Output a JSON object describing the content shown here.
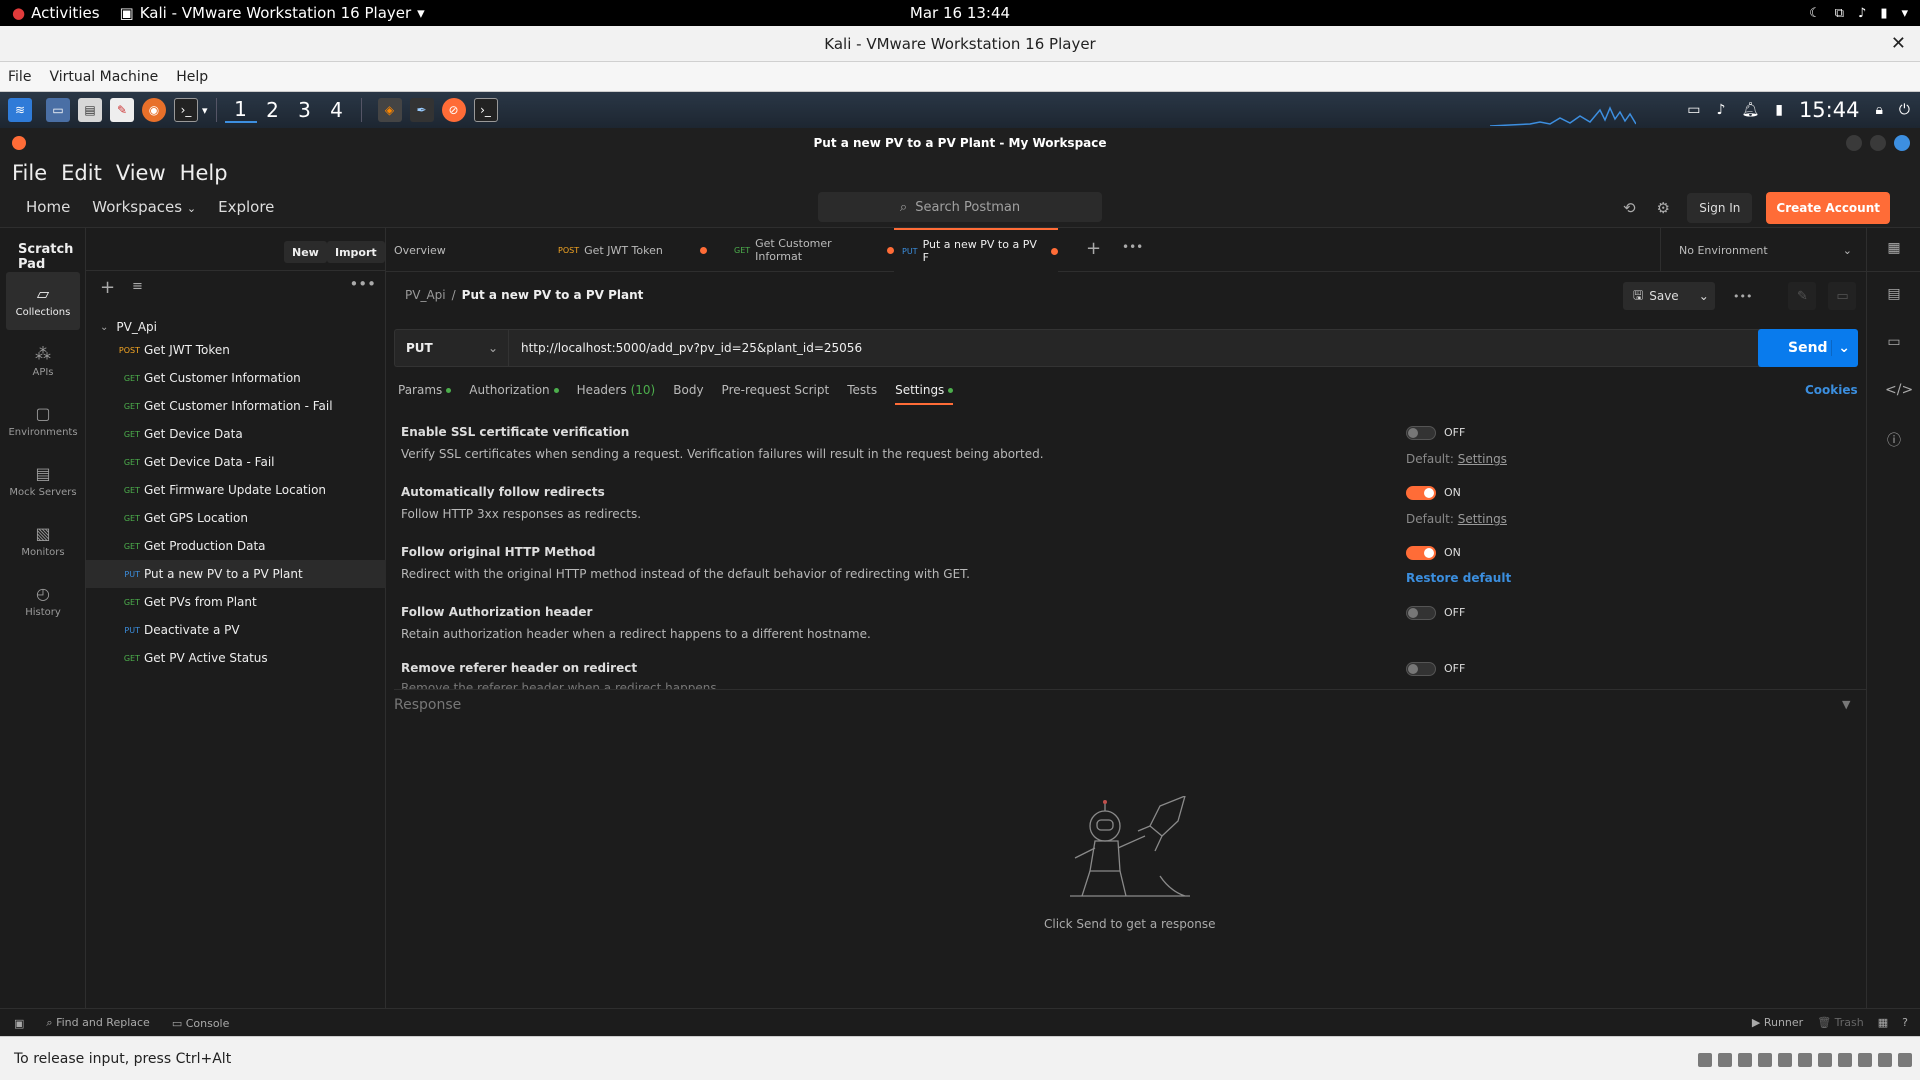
{
  "gnome": {
    "activities": "Activities",
    "app_title": "Kali - VMware Workstation 16 Player",
    "clock": "Mar 16  13:44"
  },
  "vmware": {
    "title": "Kali - VMware Workstation 16 Player",
    "menu": [
      "File",
      "Virtual Machine",
      "Help"
    ],
    "status_hint": "To release input, press Ctrl+Alt"
  },
  "kali_panel": {
    "workspaces": [
      "1",
      "2",
      "3",
      "4"
    ],
    "active_workspace": "1",
    "time": "15:44"
  },
  "postman": {
    "window_title": "Put a new PV to a PV Plant - My Workspace",
    "menu": [
      "File",
      "Edit",
      "View",
      "Help"
    ],
    "nav": {
      "home": "Home",
      "workspaces": "Workspaces",
      "explore": "Explore"
    },
    "search_placeholder": "Search Postman",
    "sign_in": "Sign In",
    "create_account": "Create Account",
    "scratch_pad": "Scratch Pad",
    "new_btn": "New",
    "import_btn": "Import",
    "rail": [
      "Collections",
      "APIs",
      "Environments",
      "Mock Servers",
      "Monitors",
      "History"
    ],
    "collection": "PV_Api",
    "requests": [
      {
        "method": "POST",
        "name": "Get JWT Token"
      },
      {
        "method": "GET",
        "name": "Get Customer Information"
      },
      {
        "method": "GET",
        "name": "Get Customer Information - Fail"
      },
      {
        "method": "GET",
        "name": "Get Device Data"
      },
      {
        "method": "GET",
        "name": "Get Device Data - Fail"
      },
      {
        "method": "GET",
        "name": "Get Firmware Update Location"
      },
      {
        "method": "GET",
        "name": "Get GPS Location"
      },
      {
        "method": "GET",
        "name": "Get Production Data"
      },
      {
        "method": "PUT",
        "name": "Put a new PV to a PV Plant"
      },
      {
        "method": "GET",
        "name": "Get PVs from Plant"
      },
      {
        "method": "PUT",
        "name": "Deactivate a PV"
      },
      {
        "method": "GET",
        "name": "Get PV Active Status"
      }
    ],
    "tabs": [
      {
        "method": "",
        "label": "Overview"
      },
      {
        "method": "POST",
        "label": "Get JWT Token"
      },
      {
        "method": "GET",
        "label": "Get Customer Informat"
      },
      {
        "method": "PUT",
        "label": "Put a new PV to a PV F"
      }
    ],
    "environment": "No Environment",
    "breadcrumb": {
      "parent": "PV_Api",
      "sep": "/",
      "current": "Put a new PV to a PV Plant"
    },
    "save": "Save",
    "method": "PUT",
    "url": "http://localhost:5000/add_pv?pv_id=25&plant_id=25056",
    "send": "Send",
    "req_tabs": {
      "params": "Params",
      "authorization": "Authorization",
      "headers": "Headers",
      "headers_count": "(10)",
      "body": "Body",
      "prerequest": "Pre-request Script",
      "tests": "Tests",
      "settings": "Settings"
    },
    "cookies": "Cookies",
    "settings": [
      {
        "title": "Enable SSL certificate verification",
        "desc": "Verify SSL certificates when sending a request. Verification failures will result in the request being aborted.",
        "state": "OFF",
        "default_prefix": "Default:",
        "default_link": "Settings"
      },
      {
        "title": "Automatically follow redirects",
        "desc": "Follow HTTP 3xx responses as redirects.",
        "state": "ON",
        "default_prefix": "Default:",
        "default_link": "Settings"
      },
      {
        "title": "Follow original HTTP Method",
        "desc": "Redirect with the original HTTP method instead of the default behavior of redirecting with GET.",
        "state": "ON",
        "restore": "Restore default"
      },
      {
        "title": "Follow Authorization header",
        "desc": "Retain authorization header when a redirect happens to a different hostname.",
        "state": "OFF"
      },
      {
        "title": "Remove referer header on redirect",
        "desc": "Remove the referer header when a redirect happens.",
        "state": "OFF"
      }
    ],
    "response_label": "Response",
    "empty_response": "Click Send to get a response",
    "statusbar": {
      "find": "Find and Replace",
      "console": "Console",
      "runner": "Runner",
      "trash": "Trash"
    }
  },
  "colors": {
    "accent": "#ff6c37",
    "send_blue": "#097bed",
    "get_green": "#4cae4c",
    "post_orange": "#f5a623",
    "put_blue": "#3b8ede"
  }
}
